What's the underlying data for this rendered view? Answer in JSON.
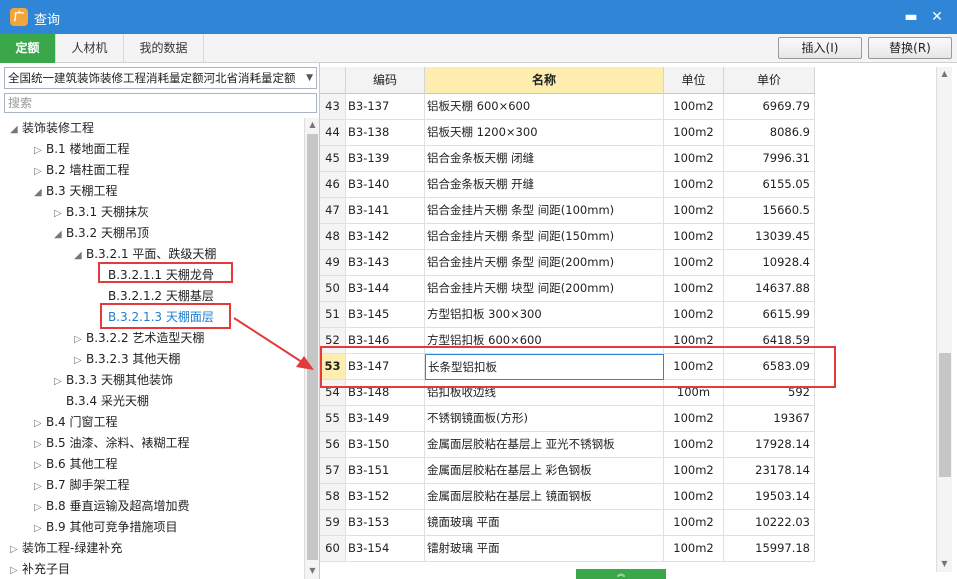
{
  "window": {
    "title": "查询",
    "app_icon_glyph": "广",
    "minimize_glyph": "▬",
    "close_glyph": "✕"
  },
  "tabs": [
    {
      "label": "定额",
      "active": true
    },
    {
      "label": "人材机",
      "active": false
    },
    {
      "label": "我的数据",
      "active": false
    }
  ],
  "actions": {
    "insert": "插入(I)",
    "replace": "替换(R)"
  },
  "library": {
    "value": "全国统一建筑装饰装修工程消耗量定额河北省消耗量定额",
    "search_placeholder": "搜索"
  },
  "tree": [
    {
      "label": "装饰装修工程",
      "arrow": "◢"
    },
    {
      "label": "B.1 楼地面工程",
      "arrow": "▷"
    },
    {
      "label": "B.2 墙柱面工程",
      "arrow": "▷"
    },
    {
      "label": "B.3 天棚工程",
      "arrow": "◢"
    },
    {
      "label": "B.3.1 天棚抹灰",
      "arrow": "▷"
    },
    {
      "label": "B.3.2 天棚吊顶",
      "arrow": "◢"
    },
    {
      "label": "B.3.2.1 平面、跌级天棚",
      "arrow": "◢"
    },
    {
      "label": "B.3.2.1.1 天棚龙骨",
      "arrow": ""
    },
    {
      "label": "B.3.2.1.2 天棚基层",
      "arrow": ""
    },
    {
      "label": "B.3.2.1.3 天棚面层",
      "arrow": ""
    },
    {
      "label": "B.3.2.2 艺术造型天棚",
      "arrow": "▷"
    },
    {
      "label": "B.3.2.3 其他天棚",
      "arrow": "▷"
    },
    {
      "label": "B.3.3 天棚其他装饰",
      "arrow": "▷"
    },
    {
      "label": "B.3.4 采光天棚",
      "arrow": ""
    },
    {
      "label": "B.4 门窗工程",
      "arrow": "▷"
    },
    {
      "label": "B.5 油漆、涂料、裱糊工程",
      "arrow": "▷"
    },
    {
      "label": "B.6 其他工程",
      "arrow": "▷"
    },
    {
      "label": "B.7 脚手架工程",
      "arrow": "▷"
    },
    {
      "label": "B.8 垂直运输及超高增加费",
      "arrow": "▷"
    },
    {
      "label": "B.9 其他可竞争措施项目",
      "arrow": "▷"
    },
    {
      "label": "装饰工程-绿建补充",
      "arrow": "▷"
    },
    {
      "label": "补充子目",
      "arrow": "▷"
    }
  ],
  "grid": {
    "headers": {
      "code": "编码",
      "name": "名称",
      "unit": "单位",
      "price": "单价"
    },
    "rows": [
      {
        "no": "43",
        "code": "B3-137",
        "name": "铝板天棚 600×600",
        "unit": "100m2",
        "price": "6969.79"
      },
      {
        "no": "44",
        "code": "B3-138",
        "name": "铝板天棚 1200×300",
        "unit": "100m2",
        "price": "8086.9"
      },
      {
        "no": "45",
        "code": "B3-139",
        "name": "铝合金条板天棚 闭缝",
        "unit": "100m2",
        "price": "7996.31"
      },
      {
        "no": "46",
        "code": "B3-140",
        "name": "铝合金条板天棚 开缝",
        "unit": "100m2",
        "price": "6155.05"
      },
      {
        "no": "47",
        "code": "B3-141",
        "name": "铝合金挂片天棚 条型 间距(100mm)",
        "unit": "100m2",
        "price": "15660.5"
      },
      {
        "no": "48",
        "code": "B3-142",
        "name": "铝合金挂片天棚 条型 间距(150mm)",
        "unit": "100m2",
        "price": "13039.45"
      },
      {
        "no": "49",
        "code": "B3-143",
        "name": "铝合金挂片天棚 条型 间距(200mm)",
        "unit": "100m2",
        "price": "10928.4"
      },
      {
        "no": "50",
        "code": "B3-144",
        "name": "铝合金挂片天棚 块型 间距(200mm)",
        "unit": "100m2",
        "price": "14637.88"
      },
      {
        "no": "51",
        "code": "B3-145",
        "name": "方型铝扣板 300×300",
        "unit": "100m2",
        "price": "6615.99"
      },
      {
        "no": "52",
        "code": "B3-146",
        "name": "方型铝扣板 600×600",
        "unit": "100m2",
        "price": "6418.59"
      },
      {
        "no": "53",
        "code": "B3-147",
        "name": "长条型铝扣板",
        "unit": "100m2",
        "price": "6583.09"
      },
      {
        "no": "54",
        "code": "B3-148",
        "name": "铝扣板收边线",
        "unit": "100m",
        "price": "592"
      },
      {
        "no": "55",
        "code": "B3-149",
        "name": "不锈钢镜面板(方形)",
        "unit": "100m2",
        "price": "19367"
      },
      {
        "no": "56",
        "code": "B3-150",
        "name": "金属面层胶粘在基层上 亚光不锈钢板",
        "unit": "100m2",
        "price": "17928.14"
      },
      {
        "no": "57",
        "code": "B3-151",
        "name": "金属面层胶粘在基层上 彩色钢板",
        "unit": "100m2",
        "price": "23178.14"
      },
      {
        "no": "58",
        "code": "B3-152",
        "name": "金属面层胶粘在基层上 镜面钢板",
        "unit": "100m2",
        "price": "19503.14"
      },
      {
        "no": "59",
        "code": "B3-153",
        "name": "镜面玻璃 平面",
        "unit": "100m2",
        "price": "10222.03"
      },
      {
        "no": "60",
        "code": "B3-154",
        "name": "镭射玻璃 平面",
        "unit": "100m2",
        "price": "15997.18"
      }
    ]
  },
  "colors": {
    "titlebar": "#2f86d6",
    "accent_green": "#3aa84a",
    "annotation_red": "#e23b3b",
    "header_sorted": "#fdeeb0"
  }
}
